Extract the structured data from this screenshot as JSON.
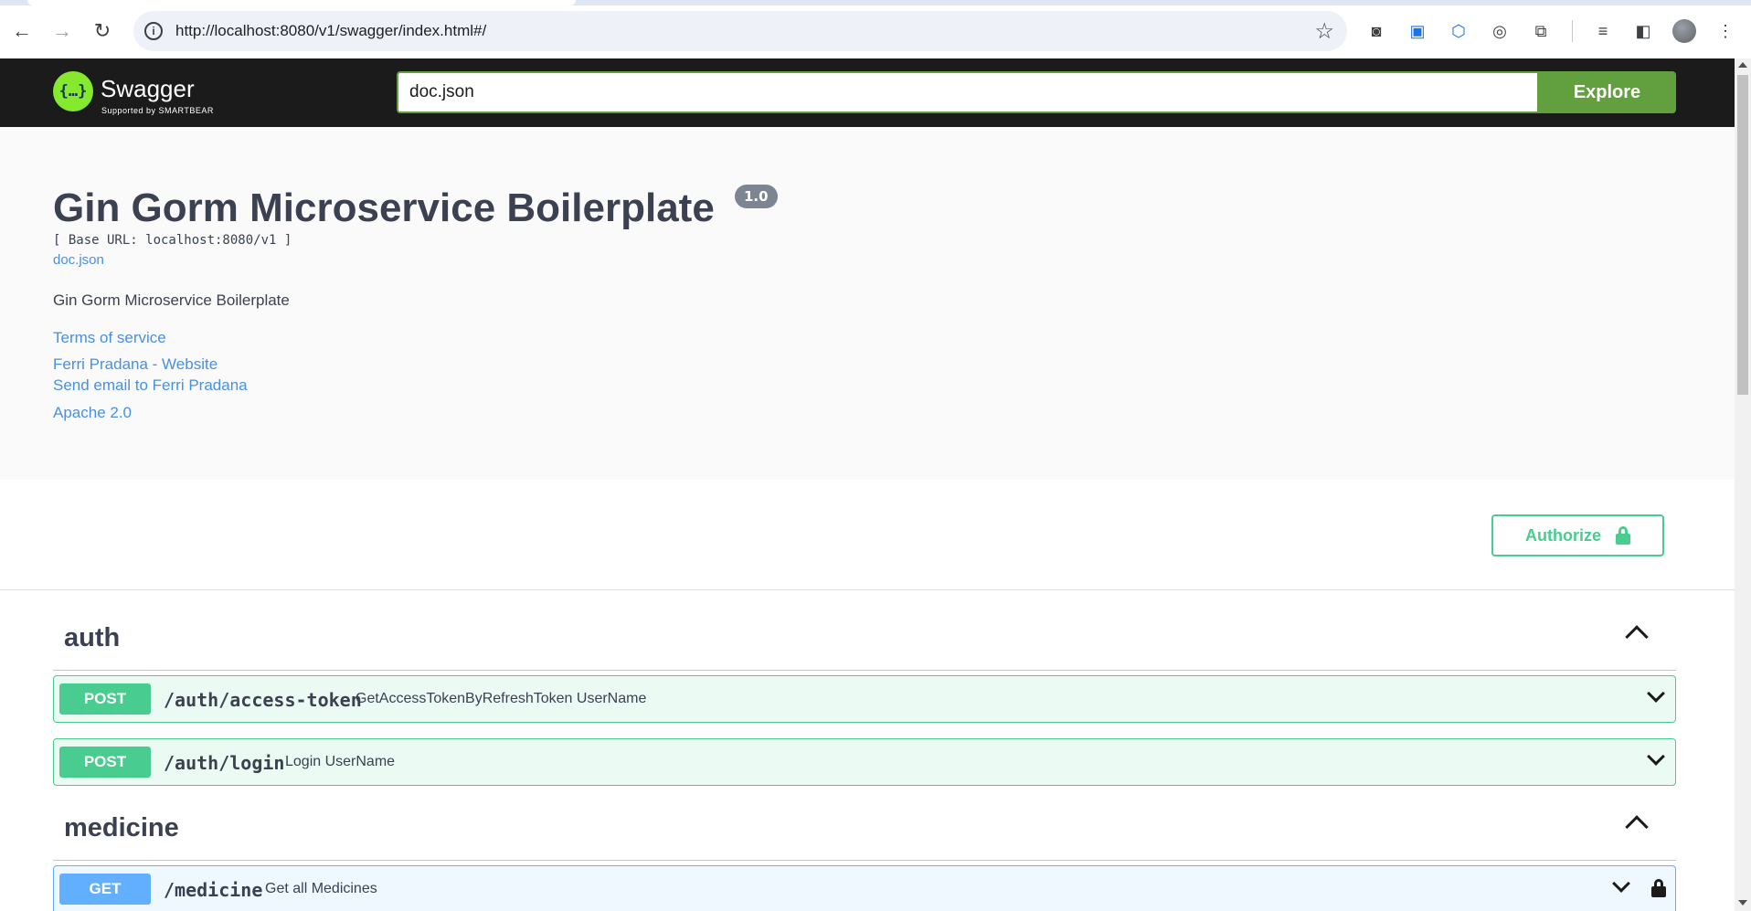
{
  "browser": {
    "url": "http://localhost:8080/v1/swagger/index.html#/",
    "back_icon": "←",
    "forward_icon": "→",
    "reload_icon": "↻",
    "star_icon": "☆"
  },
  "topbar": {
    "logo_glyph": "{…}",
    "logo_text": "Swagger",
    "logo_sub": "Supported by SMARTBEAR",
    "search_value": "doc.json",
    "explore_label": "Explore",
    "accent_color": "#62a03f"
  },
  "info": {
    "title": "Gin Gorm Microservice Boilerplate",
    "version": "1.0",
    "base_url": "[ Base URL: localhost:8080/v1 ]",
    "doc_link": "doc.json",
    "description": "Gin Gorm Microservice Boilerplate",
    "terms": "Terms of service",
    "contact_website": "Ferri Pradana - Website",
    "contact_email": "Send email to Ferri Pradana",
    "license": "Apache 2.0"
  },
  "scheme": {
    "authorize_label": "Authorize"
  },
  "tags": [
    {
      "name": "auth",
      "operations": [
        {
          "method": "POST",
          "path": "/auth/access-token",
          "summary": "GetAccessTokenByRefreshToken UserName"
        },
        {
          "method": "POST",
          "path": "/auth/login",
          "summary": "Login UserName"
        }
      ]
    },
    {
      "name": "medicine",
      "operations": [
        {
          "method": "GET",
          "path": "/medicine",
          "summary": "Get all Medicines"
        }
      ]
    }
  ],
  "colors": {
    "post": "#49cc90",
    "get": "#61affe",
    "link": "#4990e2",
    "text": "#3b4151"
  }
}
